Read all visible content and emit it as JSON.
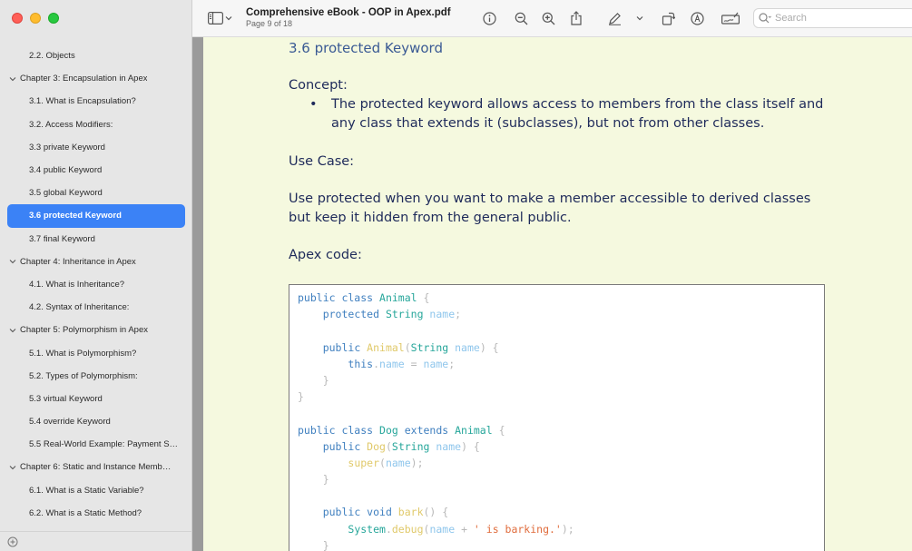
{
  "window": {
    "title": "Comprehensive eBook - OOP in Apex.pdf",
    "subtitle": "Page 9 of 18"
  },
  "search": {
    "placeholder": "Search"
  },
  "sidebar": {
    "items": [
      {
        "label": "2.2. Objects",
        "type": "section"
      },
      {
        "label": "Chapter 3: Encapsulation in Apex",
        "type": "chapter"
      },
      {
        "label": "3.1. What is Encapsulation?",
        "type": "section"
      },
      {
        "label": "3.2. Access Modifiers:",
        "type": "section"
      },
      {
        "label": "3.3 private Keyword",
        "type": "section"
      },
      {
        "label": "3.4 public Keyword",
        "type": "section"
      },
      {
        "label": "3.5 global Keyword",
        "type": "section"
      },
      {
        "label": "3.6 protected Keyword",
        "type": "section",
        "selected": true
      },
      {
        "label": "3.7 final Keyword",
        "type": "section"
      },
      {
        "label": "Chapter 4: Inheritance in Apex",
        "type": "chapter"
      },
      {
        "label": "4.1. What is Inheritance?",
        "type": "section"
      },
      {
        "label": "4.2. Syntax of Inheritance:",
        "type": "section"
      },
      {
        "label": "Chapter 5: Polymorphism in Apex",
        "type": "chapter"
      },
      {
        "label": "5.1. What is Polymorphism?",
        "type": "section"
      },
      {
        "label": "5.2. Types of Polymorphism:",
        "type": "section"
      },
      {
        "label": "5.3 virtual Keyword",
        "type": "section"
      },
      {
        "label": "5.4 override Keyword",
        "type": "section"
      },
      {
        "label": "5.5 Real-World Example: Payment Sys...",
        "type": "section"
      },
      {
        "label": "Chapter 6: Static and Instance Members...",
        "type": "chapter"
      },
      {
        "label": "6.1. What is a Static Variable?",
        "type": "section"
      },
      {
        "label": "6.2. What is a Static Method?",
        "type": "section"
      }
    ]
  },
  "document": {
    "section_heading": "3.6 protected Keyword",
    "concept_label": "Concept:",
    "bullet_text": "The protected keyword allows access to members from the class itself and any class that extends it (subclasses), but not from other classes.",
    "use_case_label": "Use Case:",
    "use_case_text": "Use protected when you want to make a member accessible to derived classes but keep it hidden from the general public.",
    "apex_code_label": "Apex code:",
    "code_lines": [
      [
        [
          "kw",
          "public class "
        ],
        [
          "ty",
          "Animal"
        ],
        [
          "pn",
          " {"
        ]
      ],
      [
        [
          "pn",
          "    "
        ],
        [
          "kw",
          "protected "
        ],
        [
          "ty",
          "String "
        ],
        [
          "vr",
          "name"
        ],
        [
          "pn",
          ";"
        ]
      ],
      [],
      [
        [
          "pn",
          "    "
        ],
        [
          "kw",
          "public "
        ],
        [
          "fn",
          "Animal"
        ],
        [
          "pn",
          "("
        ],
        [
          "ty",
          "String "
        ],
        [
          "vr",
          "name"
        ],
        [
          "pn",
          ") {"
        ]
      ],
      [
        [
          "pn",
          "        "
        ],
        [
          "kw",
          "this"
        ],
        [
          "pn",
          "."
        ],
        [
          "vr",
          "name"
        ],
        [
          "pn",
          " = "
        ],
        [
          "vr",
          "name"
        ],
        [
          "pn",
          ";"
        ]
      ],
      [
        [
          "pn",
          "    }"
        ]
      ],
      [
        [
          "pn",
          "}"
        ]
      ],
      [],
      [
        [
          "kw",
          "public class "
        ],
        [
          "ty",
          "Dog "
        ],
        [
          "kw",
          "extends "
        ],
        [
          "ty",
          "Animal"
        ],
        [
          "pn",
          " {"
        ]
      ],
      [
        [
          "pn",
          "    "
        ],
        [
          "kw",
          "public "
        ],
        [
          "fn",
          "Dog"
        ],
        [
          "pn",
          "("
        ],
        [
          "ty",
          "String "
        ],
        [
          "vr",
          "name"
        ],
        [
          "pn",
          ") {"
        ]
      ],
      [
        [
          "pn",
          "        "
        ],
        [
          "fn",
          "super"
        ],
        [
          "pn",
          "("
        ],
        [
          "vr",
          "name"
        ],
        [
          "pn",
          ");"
        ]
      ],
      [
        [
          "pn",
          "    }"
        ]
      ],
      [],
      [
        [
          "pn",
          "    "
        ],
        [
          "kw",
          "public void "
        ],
        [
          "fn",
          "bark"
        ],
        [
          "pn",
          "() {"
        ]
      ],
      [
        [
          "pn",
          "        "
        ],
        [
          "ty",
          "System"
        ],
        [
          "pn",
          "."
        ],
        [
          "fn",
          "debug"
        ],
        [
          "pn",
          "("
        ],
        [
          "vr",
          "name"
        ],
        [
          "pn",
          " + "
        ],
        [
          "st",
          "' is barking.'"
        ],
        [
          "pn",
          ");"
        ]
      ],
      [
        [
          "pn",
          "    }"
        ]
      ]
    ]
  },
  "colors": {
    "accent": "#3b82f6",
    "page_background": "#f5f9df",
    "text": "#1e2a5a"
  }
}
